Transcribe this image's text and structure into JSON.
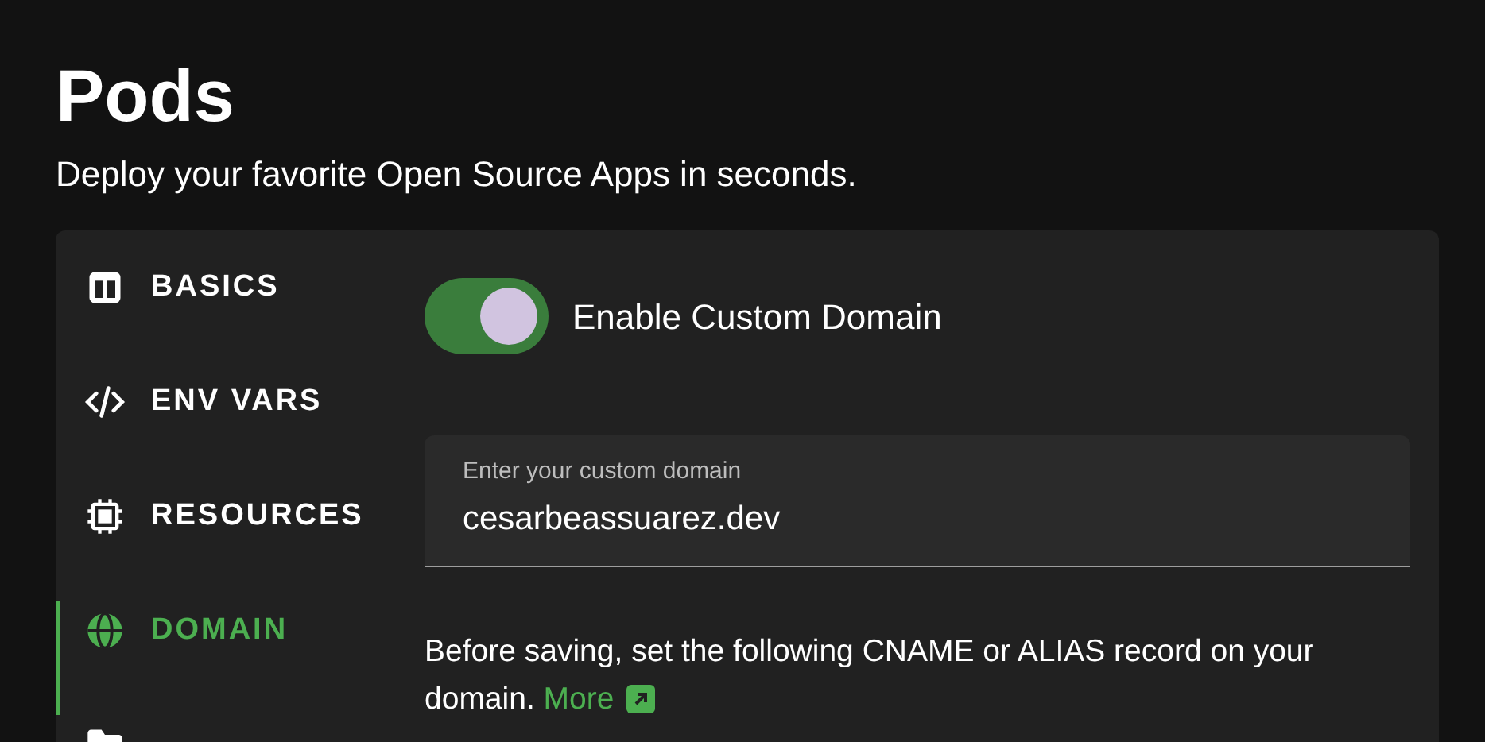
{
  "page": {
    "title": "Pods",
    "subtitle": "Deploy your favorite Open Source Apps in seconds."
  },
  "sidebar": {
    "items": [
      {
        "label": "BASICS",
        "selected": false
      },
      {
        "label": "ENV VARS",
        "selected": false
      },
      {
        "label": "RESOURCES",
        "selected": false
      },
      {
        "label": "DOMAIN",
        "selected": true
      },
      {
        "selected": false
      }
    ]
  },
  "custom_domain": {
    "label": "Enable Custom Domain",
    "on": true
  },
  "domain_field": {
    "label": "Enter your custom domain",
    "value": "cesarbeassuarez.dev"
  },
  "note": {
    "text": "Before saving, set the following CNAME or ALIAS record on your domain.",
    "link": "More"
  }
}
